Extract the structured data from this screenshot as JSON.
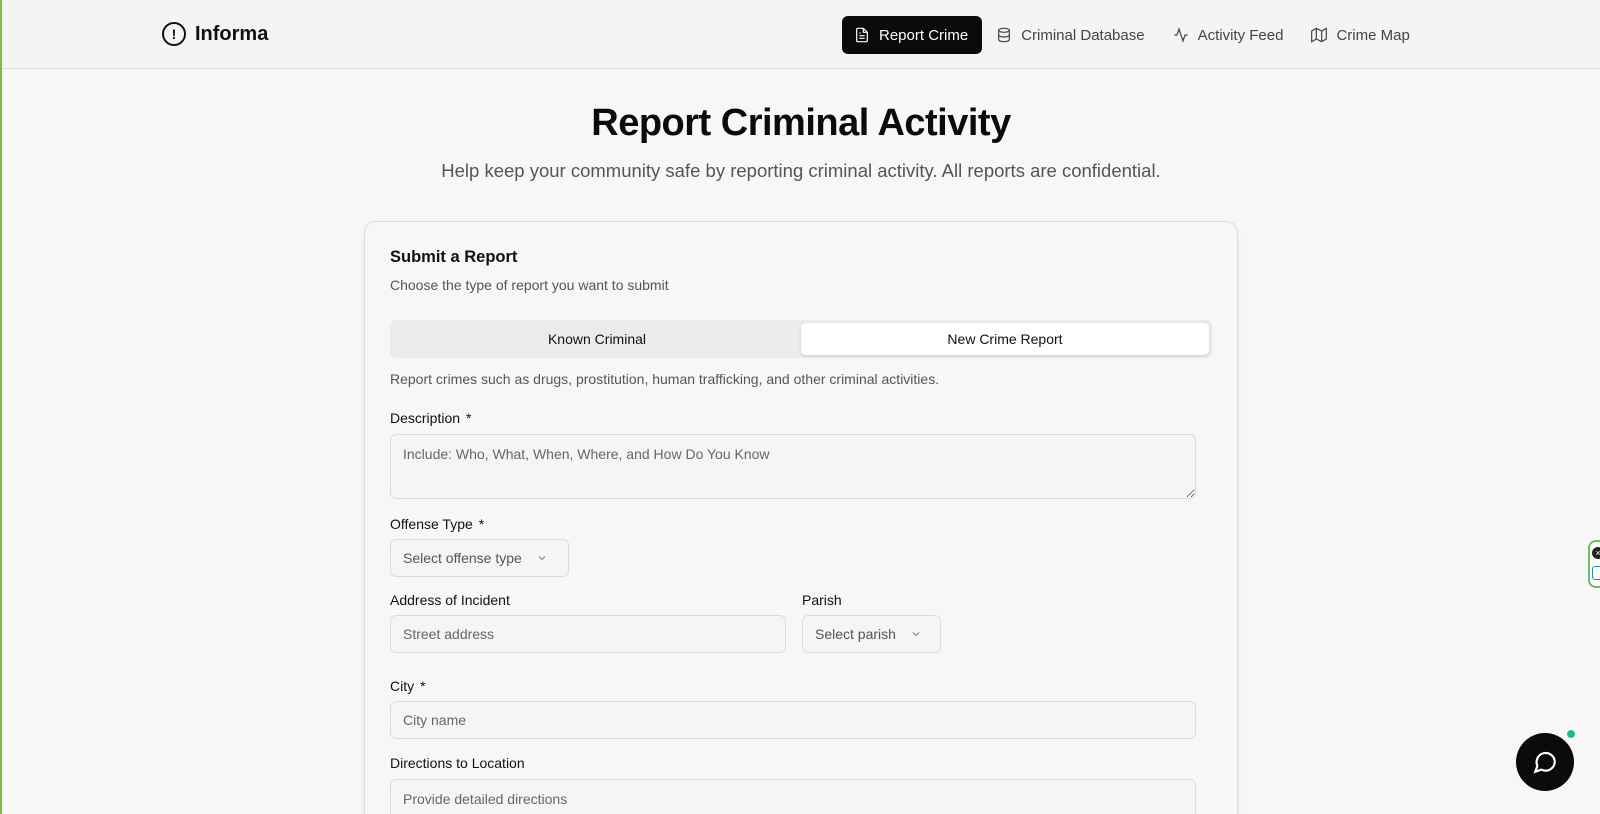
{
  "header": {
    "logo_text": "Informa",
    "nav": [
      {
        "label": "Report Crime",
        "icon": "file-text-icon",
        "active": true
      },
      {
        "label": "Criminal Database",
        "icon": "database-icon",
        "active": false
      },
      {
        "label": "Activity Feed",
        "icon": "activity-icon",
        "active": false
      },
      {
        "label": "Crime Map",
        "icon": "map-icon",
        "active": false
      }
    ]
  },
  "hero": {
    "title": "Report Criminal Activity",
    "subtitle": "Help keep your community safe by reporting criminal activity. All reports are confidential."
  },
  "card": {
    "title": "Submit a Report",
    "subtitle": "Choose the type of report you want to submit",
    "tabs": [
      {
        "label": "Known Criminal",
        "active": false
      },
      {
        "label": "New Crime Report",
        "active": true
      }
    ],
    "tab_description": "Report crimes such as drugs, prostitution, human trafficking, and other criminal activities.",
    "fields": {
      "description": {
        "label": "Description",
        "required": "*",
        "placeholder": "Include: Who, What, When, Where, and How Do You Know"
      },
      "offense_type": {
        "label": "Offense Type",
        "required": "*",
        "placeholder": "Select offense type"
      },
      "address": {
        "label": "Address of Incident",
        "placeholder": "Street address"
      },
      "parish": {
        "label": "Parish",
        "placeholder": "Select parish"
      },
      "city": {
        "label": "City",
        "required": "*",
        "placeholder": "City name"
      },
      "directions": {
        "label": "Directions to Location",
        "placeholder": "Provide detailed directions"
      }
    }
  },
  "colors": {
    "active_nav_bg": "#0b0b0b",
    "chat_status": "#17c087"
  }
}
